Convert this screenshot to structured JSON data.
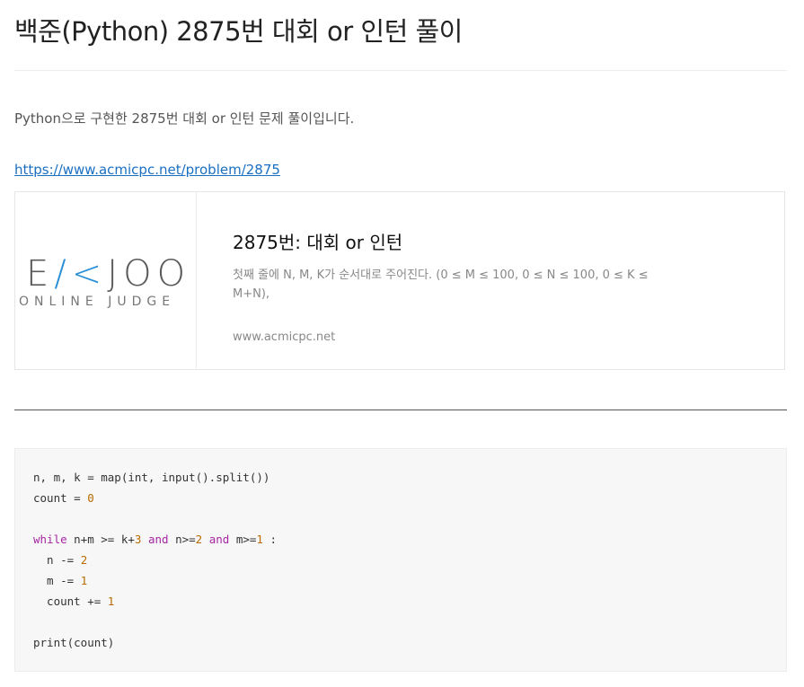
{
  "post": {
    "title": "백준(Python) 2875번 대회 or 인턴 풀이",
    "intro": "Python으로 구현한 2875번 대회 or 인턴 문제 풀이입니다.",
    "link": "https://www.acmicpc.net/problem/2875"
  },
  "og_card": {
    "logo_main_a": "E",
    "logo_main_k": "/<",
    "logo_main_b": "JOO",
    "logo_sub": "ONLINE JUDGE",
    "title": "2875번: 대회 or 인턴",
    "description": "첫째 줄에 N, M, K가 순서대로 주어진다. (0 ≤ M ≤ 100, 0 ≤ N ≤ 100, 0 ≤ K ≤ M+N),",
    "host": "www.acmicpc.net"
  },
  "code": {
    "l1": "n, m, k = map(int, input().split())",
    "l2a": "count = ",
    "l2n": "0",
    "l4kw1": "while",
    "l4a": " n+m >= k+",
    "l4n1": "3",
    "l4kw2": "and",
    "l4b": " n>=",
    "l4n2": "2",
    "l4kw3": "and",
    "l4c": " m>=",
    "l4n3": "1",
    "l4d": " :",
    "l5a": "  n -= ",
    "l5n": "2",
    "l6a": "  m -= ",
    "l6n": "1",
    "l7a": "  count += ",
    "l7n": "1",
    "l9": "print(count)"
  }
}
